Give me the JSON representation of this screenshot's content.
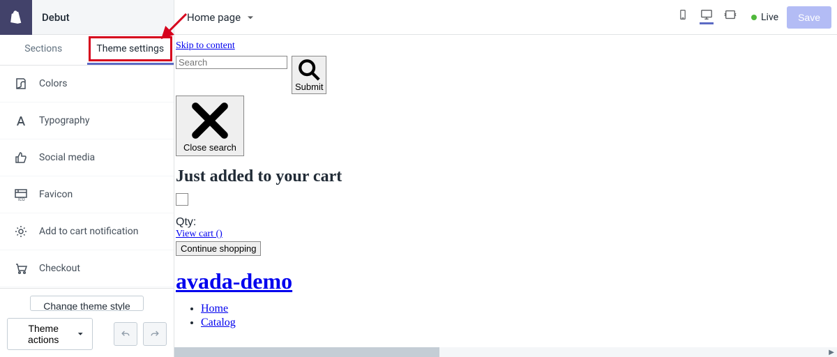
{
  "header": {
    "theme_name": "Debut",
    "page_selector": "Home page",
    "status": "Live",
    "save_btn": "Save"
  },
  "tabs": {
    "sections": "Sections",
    "theme_settings": "Theme settings"
  },
  "settings": {
    "items": [
      {
        "label": "Colors"
      },
      {
        "label": "Typography"
      },
      {
        "label": "Social media"
      },
      {
        "label": "Favicon"
      },
      {
        "label": "Add to cart notification"
      },
      {
        "label": "Checkout"
      }
    ],
    "change_style": "Change theme style",
    "theme_actions": "Theme actions"
  },
  "preview": {
    "skip_link": "Skip to content",
    "search_placeholder": "Search",
    "submit": "Submit",
    "close_search": "Close search",
    "cart_heading": "Just added to your cart",
    "qty_label": "Qty:",
    "view_cart": "View cart ()",
    "continue_shopping": "Continue shopping",
    "store_name": "avada-demo",
    "nav": {
      "home": "Home",
      "catalog": "Catalog"
    }
  }
}
